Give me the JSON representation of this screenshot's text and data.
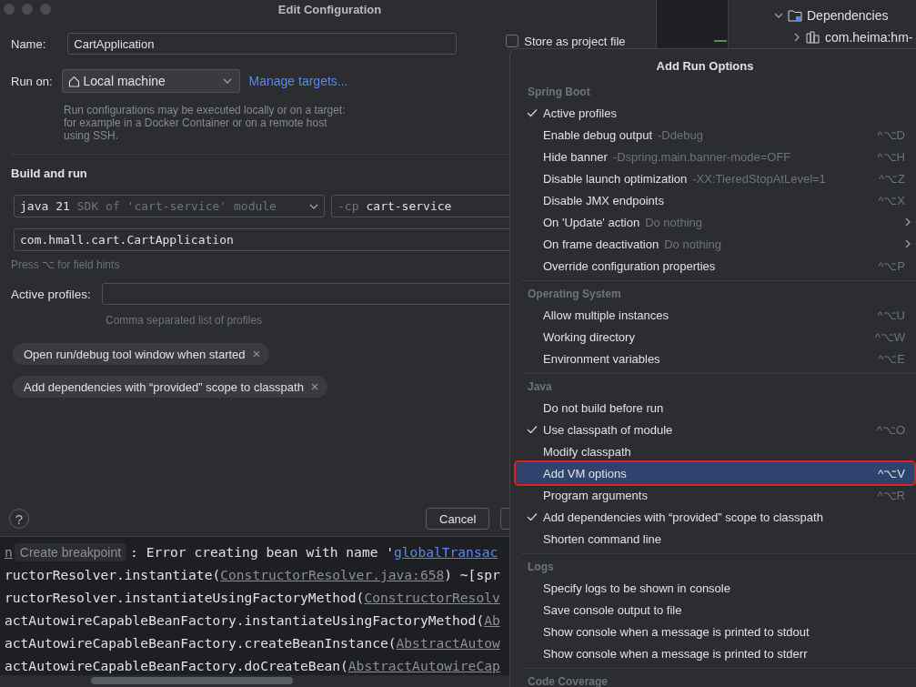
{
  "dialog": {
    "title": "Edit Configuration",
    "name": {
      "label": "Name:",
      "value": "CartApplication"
    },
    "store_as_project_file": {
      "label": "Store as project file",
      "checked": false
    },
    "run_on": {
      "label": "Run on:",
      "value": "Local machine",
      "link": "Manage targets...",
      "description": "Run configurations may be executed locally or on a target: for example in a Docker Container or on a remote host using SSH."
    },
    "build_and_run": {
      "title": "Build and run",
      "jdk": "java 21",
      "jdk_hint": "SDK of 'cart-service' module",
      "cp_flag": "-cp",
      "cp_value": "cart-service",
      "main_class": "com.hmall.cart.CartApplication",
      "hint": "Press ⌥ for field hints"
    },
    "active_profiles": {
      "label": "Active profiles:",
      "hint": "Comma separated list of profiles"
    },
    "chips": [
      "Open run/debug tool window when started",
      "Add dependencies with “provided” scope to classpath"
    ],
    "help": "?",
    "buttons": [
      "Cancel"
    ]
  },
  "console": {
    "lines": [
      [
        {
          "kind": "file",
          "text": "n"
        },
        {
          "kind": "tooltip",
          "text": "Create breakpoint"
        },
        {
          "kind": "text",
          "text": ": Error creating bean with name '"
        },
        {
          "kind": "link",
          "text": "globalTransac"
        }
      ],
      [
        {
          "kind": "text",
          "text": "ructorResolver.instantiate("
        },
        {
          "kind": "file",
          "text": "ConstructorResolver.java:658"
        },
        {
          "kind": "text",
          "text": ") ~[spr"
        }
      ],
      [
        {
          "kind": "text",
          "text": "ructorResolver.instantiateUsingFactoryMethod("
        },
        {
          "kind": "file",
          "text": "ConstructorResolv"
        }
      ],
      [
        {
          "kind": "text",
          "text": "actAutowireCapableBeanFactory.instantiateUsingFactoryMethod("
        },
        {
          "kind": "file",
          "text": "Ab"
        }
      ],
      [
        {
          "kind": "text",
          "text": "actAutowireCapableBeanFactory.createBeanInstance("
        },
        {
          "kind": "file",
          "text": "AbstractAutow"
        }
      ],
      [
        {
          "kind": "text",
          "text": "actAutowireCapableBeanFactory.doCreateBean("
        },
        {
          "kind": "file",
          "text": "AbstractAutowireCap"
        }
      ]
    ]
  },
  "project_tree": {
    "items": [
      {
        "label": "Dependencies",
        "expanded": true,
        "children": [
          {
            "label": "com.heima:hm-",
            "expanded": false
          }
        ]
      }
    ]
  },
  "run_options_popup": {
    "title": "Add Run Options",
    "sections": [
      {
        "title": "Spring Boot",
        "items": [
          {
            "label": "Active profiles",
            "checked": true,
            "selected": false
          },
          {
            "label": "Enable debug output",
            "hint": "-Ddebug",
            "shortcut": "^⌥D",
            "checked": false,
            "selected": false
          },
          {
            "label": "Hide banner",
            "hint": "-Dspring.main.banner-mode=OFF",
            "shortcut": "^⌥H",
            "checked": false,
            "selected": false
          },
          {
            "label": "Disable launch optimization",
            "hint": "-XX:TieredStopAtLevel=1",
            "shortcut": "^⌥Z",
            "checked": false,
            "selected": false
          },
          {
            "label": "Disable JMX endpoints",
            "shortcut": "^⌥X",
            "checked": false,
            "selected": false
          },
          {
            "label": "On 'Update' action",
            "hint": "Do nothing",
            "submenu": true,
            "checked": false,
            "selected": false
          },
          {
            "label": "On frame deactivation",
            "hint": "Do nothing",
            "submenu": true,
            "checked": false,
            "selected": false
          },
          {
            "label": "Override configuration properties",
            "shortcut": "^⌥P",
            "checked": false,
            "selected": false
          }
        ]
      },
      {
        "title": "Operating System",
        "items": [
          {
            "label": "Allow multiple instances",
            "shortcut": "^⌥U",
            "checked": false,
            "selected": false
          },
          {
            "label": "Working directory",
            "shortcut": "^⌥W",
            "checked": false,
            "selected": false
          },
          {
            "label": "Environment variables",
            "shortcut": "^⌥E",
            "checked": false,
            "selected": false
          }
        ]
      },
      {
        "title": "Java",
        "items": [
          {
            "label": "Do not build before run",
            "checked": false,
            "selected": false
          },
          {
            "label": "Use classpath of module",
            "shortcut": "^⌥O",
            "checked": true,
            "selected": false
          },
          {
            "label": "Modify classpath",
            "checked": false,
            "selected": false
          },
          {
            "label": "Add VM options",
            "shortcut": "^⌥V",
            "checked": false,
            "selected": true
          },
          {
            "label": "Program arguments",
            "shortcut": "^⌥R",
            "checked": false,
            "selected": false
          },
          {
            "label": "Add dependencies with “provided” scope to classpath",
            "checked": true,
            "selected": false
          },
          {
            "label": "Shorten command line",
            "checked": false,
            "selected": false
          }
        ]
      },
      {
        "title": "Logs",
        "items": [
          {
            "label": "Specify logs to be shown in console",
            "checked": false,
            "selected": false
          },
          {
            "label": "Save console output to file",
            "checked": false,
            "selected": false
          },
          {
            "label": "Show console when a message is printed to stdout",
            "checked": false,
            "selected": false
          },
          {
            "label": "Show console when a message is printed to stderr",
            "checked": false,
            "selected": false
          }
        ]
      },
      {
        "title": "Code Coverage"
      }
    ]
  }
}
